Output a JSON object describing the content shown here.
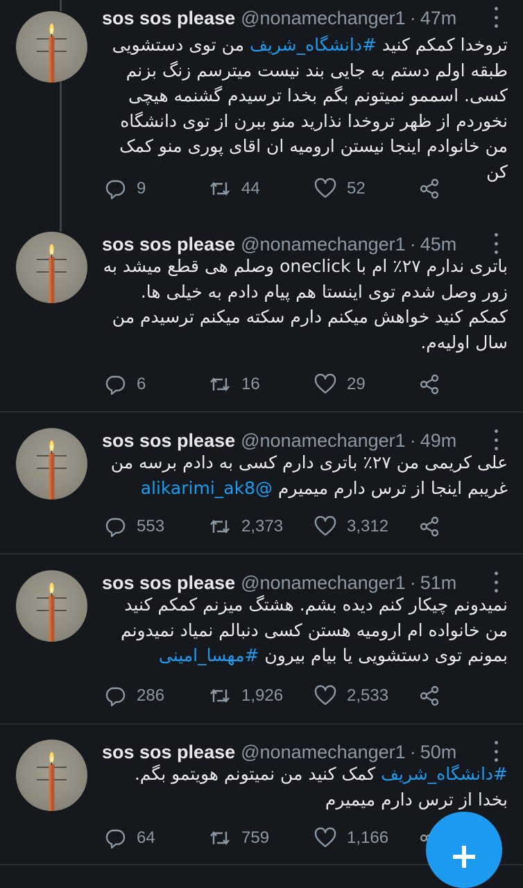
{
  "tweets": [
    {
      "name": "sos sos please",
      "handle": "@nonamechanger1",
      "time": "47m",
      "body_parts": [
        {
          "t": "تروخدا کمکم کنید ",
          "link": false
        },
        {
          "t": "#دانشگاه_شریف",
          "link": true
        },
        {
          "t": " من توی دستشویی طبقه اولم دستم به جایی بند نیست میترسم زنگ بزنم کسی. اسممو نمیتونم بگم بخدا ترسیدم گشنمه هیچی نخوردم از ظهر تروخدا نذارید منو ببرن از توی دانشگاه من خانوادم اینجا نیستن ارومیه ان اقای پوری منو کمک کن",
          "link": false
        }
      ],
      "replies": "9",
      "retweets": "44",
      "likes": "52"
    },
    {
      "name": "sos sos please",
      "handle": "@nonamechanger1",
      "time": "45m",
      "body_parts": [
        {
          "t": "باتری ندارم ۲۷٪ ام با oneclick وصلم هی قطع میشد به زور وصل شدم توی اینستا هم پیام دادم به خیلی ها. کمکم کنید خواهش میکنم دارم سکته میکنم ترسیدم من سال اولیه‌م.",
          "link": false
        }
      ],
      "replies": "6",
      "retweets": "16",
      "likes": "29"
    },
    {
      "name": "sos sos please",
      "handle": "@nonamechanger1",
      "time": "49m",
      "body_parts": [
        {
          "t": "علی کریمی من ۲۷٪ باتری دارم کسی به دادم برسه من غریبم اینجا از ترس دارم میمیرم ",
          "link": false
        },
        {
          "t": "@alikarimi_ak8",
          "link": true
        }
      ],
      "replies": "553",
      "retweets": "2,373",
      "likes": "3,312"
    },
    {
      "name": "sos sos please",
      "handle": "@nonamechanger1",
      "time": "51m",
      "body_parts": [
        {
          "t": "نمیدونم چیکار کنم دیده بشم. هشتگ میزنم کمکم کنید من خانواده ام ارومیه هستن کسی دنبالم نمیاد نمیدونم بمونم توی دستشویی یا بیام بیرون ",
          "link": false
        },
        {
          "t": "#مهسا_امینی",
          "link": true
        }
      ],
      "replies": "286",
      "retweets": "1,926",
      "likes": "2,533"
    },
    {
      "name": "sos sos please",
      "handle": "@nonamechanger1",
      "time": "50m",
      "body_parts": [
        {
          "t": "#دانشگاه_شریف",
          "link": true
        },
        {
          "t": " کمک کنید من نمیتونم هویتمو بگم. بخدا از ترس دارم میمیرم",
          "link": false
        }
      ],
      "replies": "64",
      "retweets": "759",
      "likes": "1,166"
    }
  ],
  "icons": {
    "reply": "reply-icon",
    "retweet": "retweet-icon",
    "like": "heart-icon",
    "share": "share-icon",
    "more": "more-icon",
    "compose": "plus-icon"
  },
  "colors": {
    "background": "#15181c",
    "text": "#e7e9ea",
    "muted": "#8b98a5",
    "link": "#1d9bf0",
    "fab": "#1d9bf0"
  }
}
